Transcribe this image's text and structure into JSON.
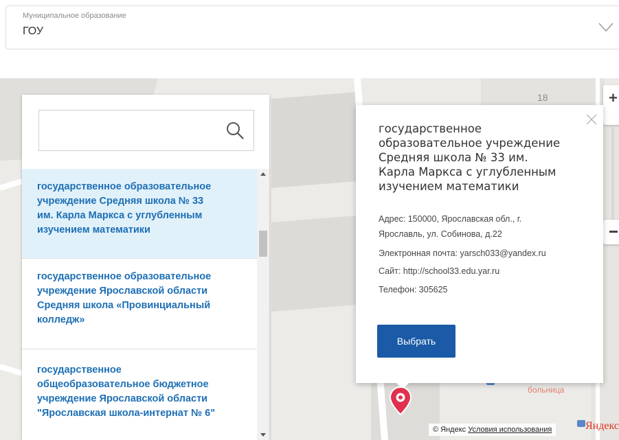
{
  "municipality": {
    "label": "Муниципальное образование",
    "value": "ГОУ"
  },
  "search": {
    "placeholder": ""
  },
  "list": {
    "items": [
      {
        "lines": [
          "государственное образовательное",
          "учреждение Средняя школа № 33",
          "им. Карла Маркса с углубленным",
          "изучением математики"
        ],
        "selected": true
      },
      {
        "lines": [
          "государственное образовательное",
          "учреждение Ярославской области",
          "Средняя школа «Провинциальный",
          "колледж»"
        ],
        "selected": false
      },
      {
        "lines": [
          "государственное",
          "общеобразовательное бюджетное",
          "учреждение Ярославской области",
          "\"Ярославская школа-интернат № 6\""
        ],
        "selected": false
      }
    ]
  },
  "balloon": {
    "title_lines": [
      "государственное",
      "образовательное учреждение",
      "Средняя школа № 33 им.",
      "Карла Маркса с углубленным",
      "изучением математики"
    ],
    "address_line1": "Адрес: 150000, Ярославская обл., г.",
    "address_line2": "Ярославль, ул. Собинова, д.22",
    "email": "Электронная почта: yarsch033@yandex.ru",
    "site": "Сайт: http://school33.edu.yar.ru",
    "phone": "Телефон: 305625",
    "select_label": "Выбрать"
  },
  "map": {
    "label_building": "18",
    "label_hospital": "больница",
    "copyright": "© Яндекс",
    "terms": "Условия использования",
    "logo": "Яндекс"
  },
  "colors": {
    "link_blue": "#1d6fb4",
    "selected_bg": "#e1f1fa",
    "button_blue": "#1a5aa6",
    "pin_red": "#e0314f"
  }
}
